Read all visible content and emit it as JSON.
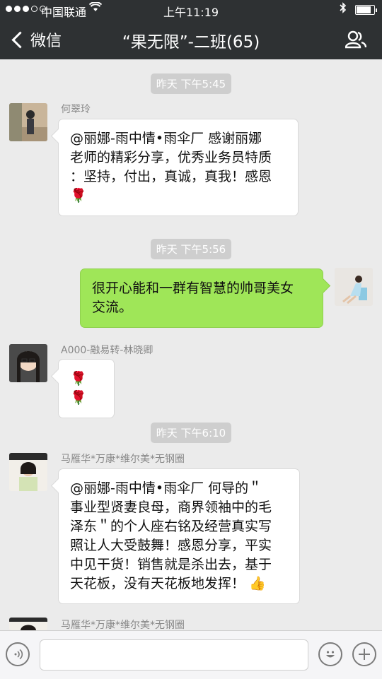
{
  "status_bar": {
    "carrier": "中国联通",
    "time": "上午11:19",
    "battery_level": 0.85
  },
  "nav": {
    "back_label": "微信",
    "title": "“果无限”-二班(65)"
  },
  "messages": [
    {
      "type": "time",
      "text": "昨天 下午5:45"
    },
    {
      "type": "text",
      "side": "left",
      "sender": "何翠玲",
      "lines": [
        "@丽娜-雨中情•雨伞厂 感谢丽娜",
        "老师的精彩分享，优秀业务员特质",
        "：坚持，付出，真诚，真我！感恩"
      ],
      "emoji_line": "🌹"
    },
    {
      "type": "time",
      "text": "昨天 下午5:56"
    },
    {
      "type": "text",
      "side": "right",
      "lines": [
        "很开心能和一群有智慧的帅哥美女",
        "交流。"
      ]
    },
    {
      "type": "text",
      "side": "left",
      "sender": "A000-融易转-林晓卿",
      "emoji_line": "🌹 🌹"
    },
    {
      "type": "time",
      "text": "昨天 下午6:10"
    },
    {
      "type": "text",
      "side": "left",
      "sender": "马雁华*万康*维尔美*无钢圈",
      "lines": [
        "@丽娜-雨中情•雨伞厂 何导的＂",
        "事业型贤妻良母，商界领袖中的毛",
        "泽东＂的个人座右铭及经营真实写",
        "照让人大受鼓舞！感恩分享，平实",
        "中见干货！销售就是杀出去，基于",
        "天花板，没有天花板地发挥！"
      ],
      "trailing_emoji": "👍"
    },
    {
      "type": "text",
      "side": "left",
      "sender": "马雁华*万康*维尔美*无钢圈"
    }
  ],
  "icons": {
    "voice": "voice-icon",
    "emoji": "emoji-icon",
    "add": "plus-icon",
    "people": "contacts-icon"
  },
  "colors": {
    "nav_bg": "#2e3133",
    "chat_bg": "#ebebeb",
    "bubble_self": "#9fe658"
  }
}
